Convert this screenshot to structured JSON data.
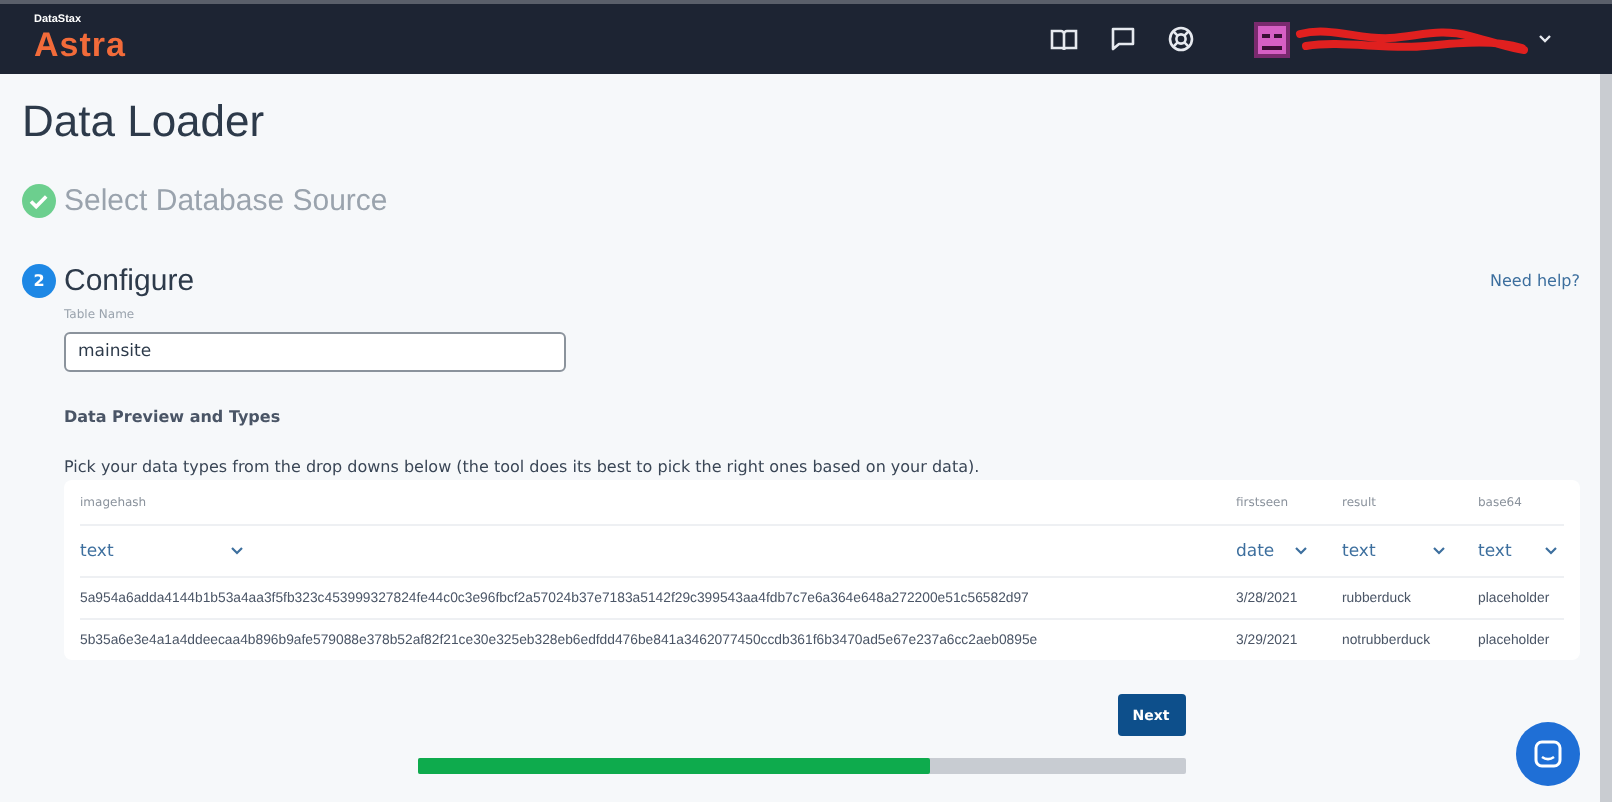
{
  "header": {
    "brand_small": "DataStax",
    "brand": "Astra"
  },
  "page": {
    "title": "Data Loader"
  },
  "steps": [
    {
      "label": "Select Database Source",
      "done": true
    },
    {
      "number": "2",
      "label": "Configure",
      "done": false
    }
  ],
  "help_link": "Need help?",
  "table_name": {
    "label": "Table Name",
    "value": "mainsite"
  },
  "preview": {
    "heading": "Data Preview and Types",
    "description": "Pick your data types from the drop downs below (the tool does its best to pick the right ones based on your data).",
    "columns": [
      {
        "name": "imagehash",
        "type": "text"
      },
      {
        "name": "firstseen",
        "type": "date"
      },
      {
        "name": "result",
        "type": "text"
      },
      {
        "name": "base64",
        "type": "text"
      }
    ],
    "rows": [
      [
        "5a954a6adda4144b1b53a4aa3f5fb323c453999327824fe44c0c3e96fbcf2a57024b37e7183a5142f29c399543aa4fdb7c7e6a364e648a272200e51c56582d97",
        "3/28/2021",
        "rubberduck",
        "placeholder"
      ],
      [
        "5b35a6e3e4a1a4ddeecaa4b896b9afe579088e378b52af82f21ce30e325eb328eb6edfdd476be841a3462077450ccdb361f6b3470ad5e67e237a6cc2aeb0895e",
        "3/29/2021",
        "notrubberduck",
        "placeholder"
      ]
    ]
  },
  "next_button": "Next",
  "progress": {
    "level": 0.667
  }
}
